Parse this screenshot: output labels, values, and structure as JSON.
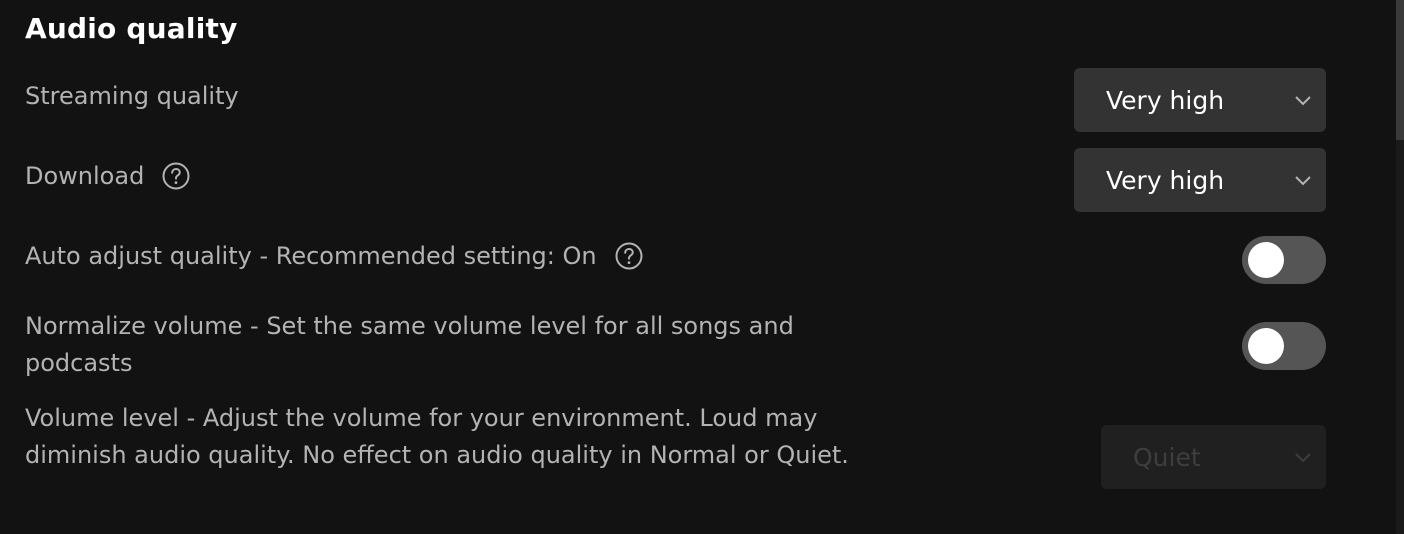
{
  "section": {
    "title": "Audio quality"
  },
  "settings": {
    "streaming_quality": {
      "label": "Streaming quality",
      "value": "Very high"
    },
    "download": {
      "label": "Download",
      "value": "Very high",
      "icon": "help-circle-icon"
    },
    "auto_adjust": {
      "label": "Auto adjust quality - Recommended setting: On",
      "icon": "help-circle-icon",
      "on": false
    },
    "normalize_volume": {
      "label": "Normalize volume - Set the same volume level for all songs and podcasts",
      "on": false
    },
    "volume_level": {
      "label": "Volume level - Adjust the volume for your environment. Loud may diminish audio quality. No effect on audio quality in Normal or Quiet.",
      "value": "Quiet",
      "disabled": true
    }
  },
  "colors": {
    "background": "#121212",
    "heading": "#ffffff",
    "label": "#b3b3b3",
    "select_bg": "#333333",
    "toggle_off": "#555555"
  }
}
